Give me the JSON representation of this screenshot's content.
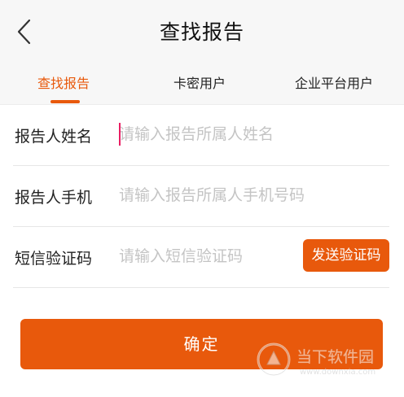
{
  "header": {
    "title": "查找报告",
    "back_icon": "chevron-left-icon"
  },
  "tabs": [
    {
      "label": "查找报告",
      "active": true
    },
    {
      "label": "卡密用户",
      "active": false
    },
    {
      "label": "企业平台用户",
      "active": false
    }
  ],
  "form": {
    "name": {
      "label": "报告人姓名",
      "value": "",
      "placeholder": "请输入报告所属人姓名"
    },
    "phone": {
      "label": "报告人手机",
      "value": "",
      "placeholder": "请输入报告所属人手机号码"
    },
    "code": {
      "label": "短信验证码",
      "value": "",
      "placeholder": "请输入短信验证码",
      "send_label": "发送验证码"
    }
  },
  "confirm_label": "确定",
  "watermark": {
    "text": "当下软件园",
    "url": "www.downxia.com"
  },
  "colors": {
    "accent": "#e8590c",
    "caret": "#e91e63",
    "header_bg": "#f7f7f7"
  }
}
